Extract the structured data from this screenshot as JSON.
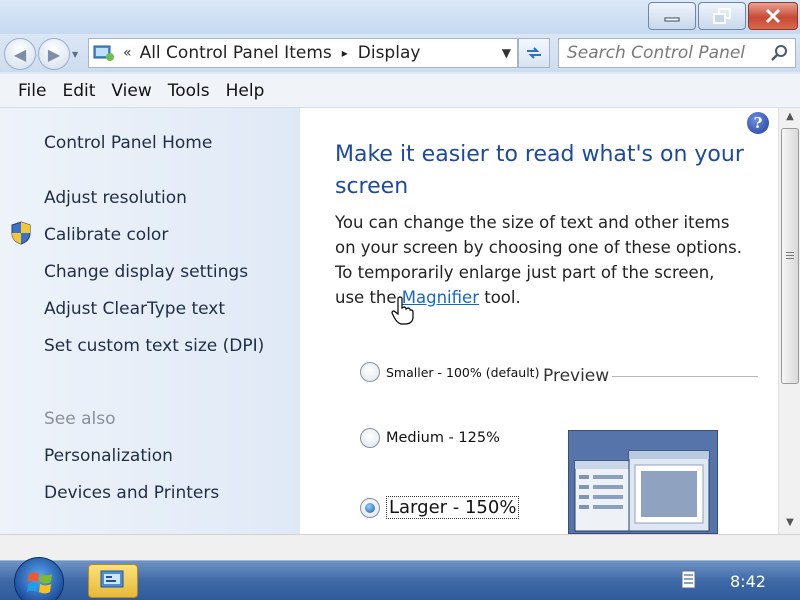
{
  "window": {
    "minimize_icon": "minimize-icon",
    "maximize_icon": "restore-icon",
    "close_icon": "close-icon"
  },
  "address": {
    "sep": "«",
    "crumbs": [
      "All Control Panel Items",
      "Display"
    ],
    "arrow": "▸"
  },
  "search": {
    "placeholder": "Search Control Panel"
  },
  "menu": {
    "file": "File",
    "edit": "Edit",
    "view": "View",
    "tools": "Tools",
    "help": "Help"
  },
  "sidebar": {
    "home": "Control Panel Home",
    "tasks": [
      "Adjust resolution",
      "Calibrate color",
      "Change display settings",
      "Adjust ClearType text",
      "Set custom text size (DPI)"
    ],
    "see_also": "See also",
    "related": [
      "Personalization",
      "Devices and Printers"
    ]
  },
  "main": {
    "help": "?",
    "title": "Make it easier to read what's on your screen",
    "desc_before": "You can change the size of text and other items on your screen by choosing one of these options. To temporarily enlarge just part of the screen, use the ",
    "desc_link": "Magnifier",
    "desc_after": " tool.",
    "options": [
      {
        "label": "Smaller - 100% (default)",
        "selected": false
      },
      {
        "label": "Medium - 125%",
        "selected": false
      },
      {
        "label": "Larger - 150%",
        "selected": true
      }
    ],
    "preview_label": "Preview"
  },
  "taskbar": {
    "clock": "8:42"
  },
  "colors": {
    "title_blue": "#1d4aa0",
    "link_blue": "#1467c7",
    "taskbar": "#3f6aa8"
  }
}
